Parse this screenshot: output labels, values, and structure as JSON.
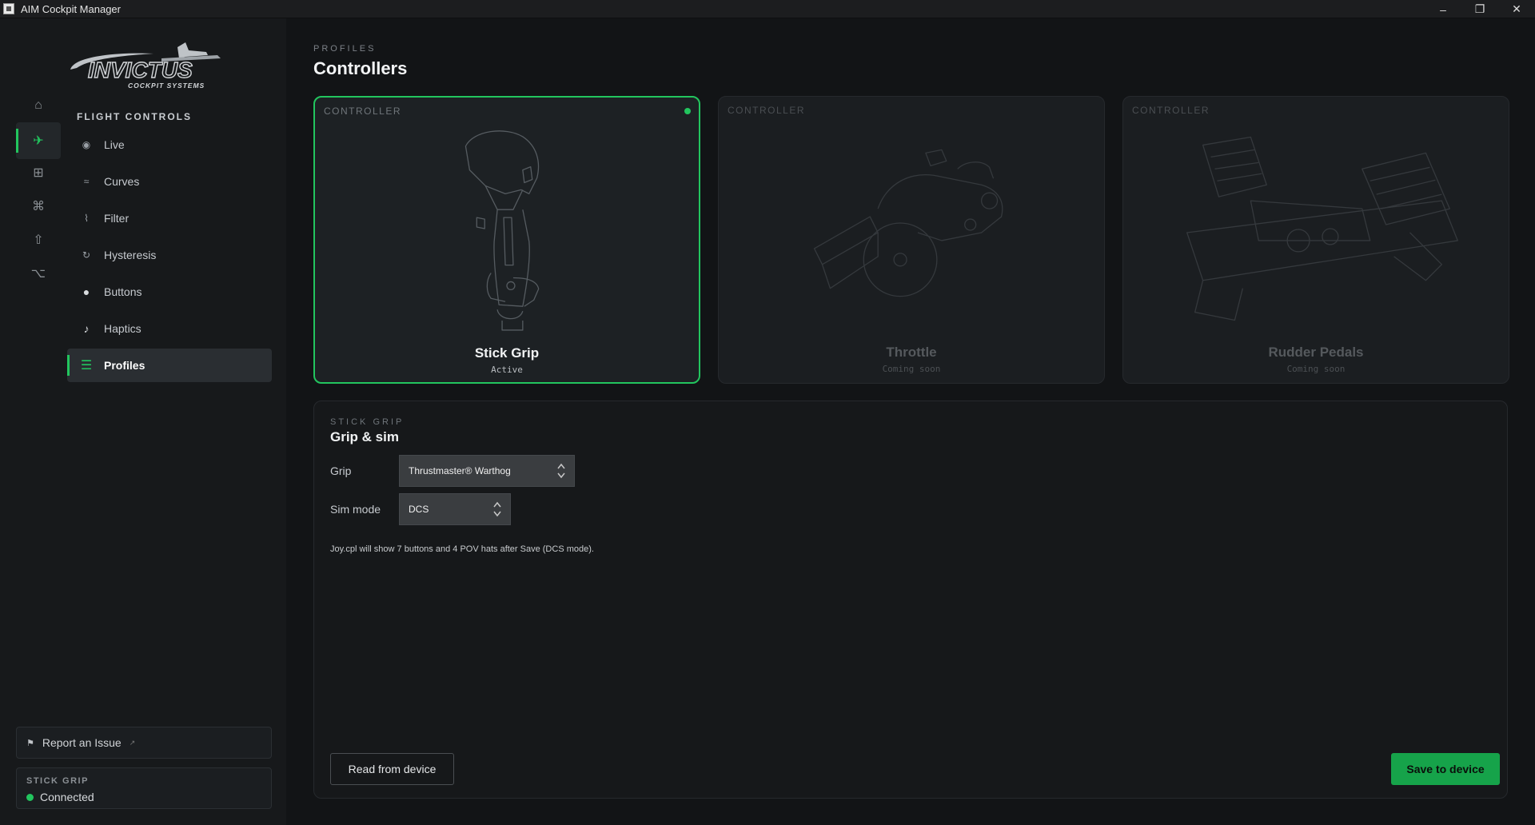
{
  "window": {
    "title": "AIM Cockpit Manager",
    "controls": [
      "–",
      "❐",
      "✕"
    ]
  },
  "logo": {
    "brand": "INVICTUS",
    "tagline": "COCKPIT SYSTEMS"
  },
  "rail": [
    {
      "icon": "home-icon",
      "glyph": "⌂",
      "active": false
    },
    {
      "icon": "plane-icon",
      "glyph": "✈",
      "active": true
    },
    {
      "icon": "grid-icon",
      "glyph": "⊞",
      "active": false
    },
    {
      "icon": "command-icon",
      "glyph": "⌘",
      "active": false
    },
    {
      "icon": "upload-icon",
      "glyph": "⇧",
      "active": false
    },
    {
      "icon": "option-icon",
      "glyph": "⌥",
      "active": false
    }
  ],
  "sidebar": {
    "section_title": "FLIGHT CONTROLS",
    "items": [
      {
        "label": "Live",
        "glyph": "◉",
        "icon": "live-icon",
        "active": false
      },
      {
        "label": "Curves",
        "glyph": "≈",
        "icon": "curves-icon",
        "active": false
      },
      {
        "label": "Filter",
        "glyph": "⌇",
        "icon": "filter-icon",
        "active": false
      },
      {
        "label": "Hysteresis",
        "glyph": "↻",
        "icon": "hysteresis-icon",
        "active": false
      },
      {
        "label": "Buttons",
        "glyph": "●",
        "icon": "buttons-icon",
        "active": false
      },
      {
        "label": "Haptics",
        "glyph": "♪",
        "icon": "haptics-icon",
        "active": false
      },
      {
        "label": "Profiles",
        "glyph": "☰",
        "icon": "profiles-icon",
        "active": true
      }
    ],
    "report": {
      "label": "Report an Issue",
      "ext": "↗"
    },
    "status": {
      "label": "STICK GRIP",
      "value": "Connected"
    }
  },
  "main": {
    "breadcrumb": "PROFILES",
    "title": "Controllers",
    "cards": [
      {
        "tag": "CONTROLLER",
        "name": "Stick Grip",
        "state": "Active",
        "active": true
      },
      {
        "tag": "CONTROLLER",
        "name": "Throttle",
        "state": "Coming soon",
        "active": false
      },
      {
        "tag": "CONTROLLER",
        "name": "Rudder Pedals",
        "state": "Coming soon",
        "active": false
      }
    ],
    "panel": {
      "tag": "STICK GRIP",
      "title": "Grip & sim",
      "grip_label": "Grip",
      "grip_value": "Thrustmaster® Warthog",
      "sim_label": "Sim mode",
      "sim_value": "DCS",
      "note": "Joy.cpl will show 7 buttons and 4 POV hats after Save (DCS mode).",
      "read_button": "Read from device",
      "save_button": "Save to device"
    }
  },
  "colors": {
    "accent": "#22c55e",
    "save": "#16a34a",
    "background": "#121416",
    "sidebar": "#17191b"
  }
}
